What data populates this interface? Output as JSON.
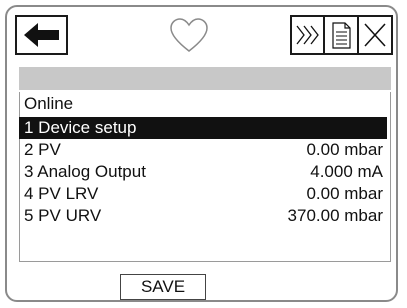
{
  "toolbar": {
    "back_icon": "arrow-left-icon",
    "favorite_icon": "heart-outline-icon",
    "forward_icon": "fast-forward-icon",
    "doc_icon": "document-icon",
    "close_icon": "close-icon"
  },
  "menu": {
    "title": "Online",
    "items": [
      {
        "label": "1 Device setup",
        "value": ""
      },
      {
        "label": "2 PV",
        "value": "0.00 mbar"
      },
      {
        "label": "3 Analog Output",
        "value": "4.000 mA"
      },
      {
        "label": "4 PV LRV",
        "value": "0.00 mbar"
      },
      {
        "label": "5 PV URV",
        "value": "370.00 mbar"
      }
    ],
    "selected_index": 0
  },
  "footer": {
    "save_label": "SAVE"
  },
  "colors": {
    "selection_bg": "#111111",
    "header_bar": "#c8c8c8"
  }
}
